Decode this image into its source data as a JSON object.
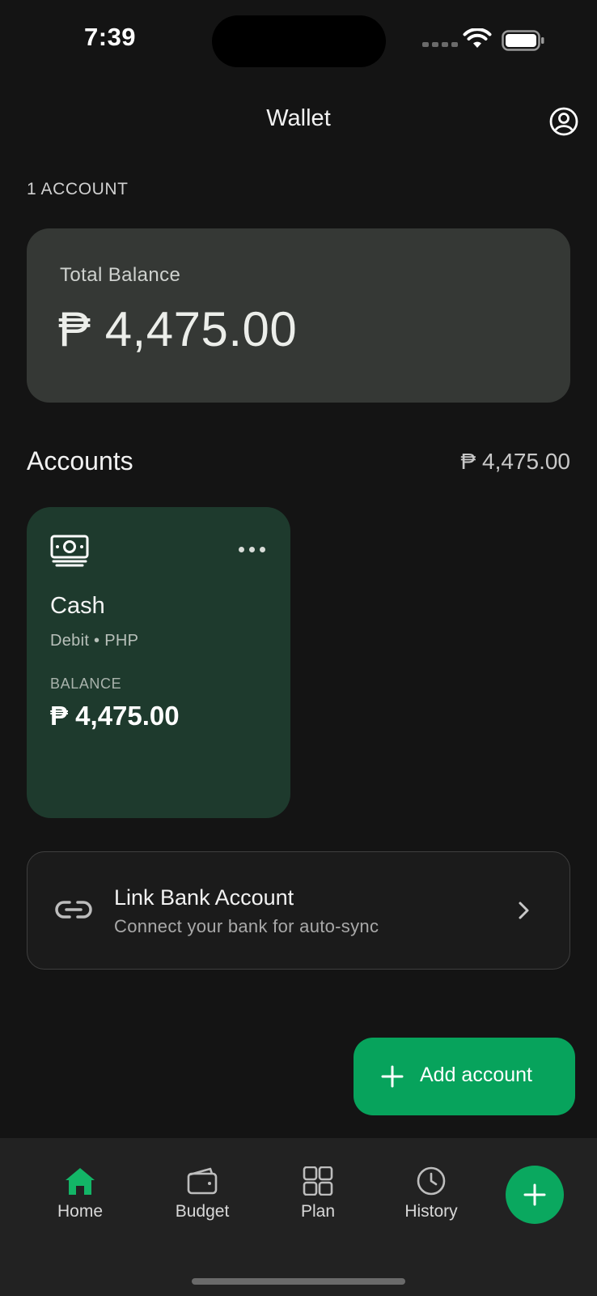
{
  "status_bar": {
    "time": "7:39"
  },
  "header": {
    "title": "Wallet",
    "profile_icon": "person-circle-icon"
  },
  "account_count": "1 ACCOUNT",
  "total_balance": {
    "label": "Total Balance",
    "amount": "₱ 4,475.00"
  },
  "accounts_section": {
    "title": "Accounts",
    "total": "₱ 4,475.00"
  },
  "accounts": [
    {
      "name": "Cash",
      "type": "Debit • PHP",
      "balance_label": "BALANCE",
      "balance": "₱ 4,475.00",
      "icon": "banknote-icon"
    }
  ],
  "link_bank": {
    "title": "Link Bank Account",
    "subtitle": "Connect your bank for auto-sync",
    "icon": "link-icon"
  },
  "add_account": {
    "label": "Add account"
  },
  "bottom_nav": {
    "items": [
      {
        "label": "Home",
        "icon": "home-icon",
        "active": true
      },
      {
        "label": "Budget",
        "icon": "wallet-icon",
        "active": false
      },
      {
        "label": "Plan",
        "icon": "grid-icon",
        "active": false
      },
      {
        "label": "History",
        "icon": "clock-icon",
        "active": false
      }
    ]
  },
  "colors": {
    "background": "#141414",
    "accent_green": "#07a35c",
    "card_dark_green": "#1e3a2d",
    "total_card": "#353835"
  }
}
